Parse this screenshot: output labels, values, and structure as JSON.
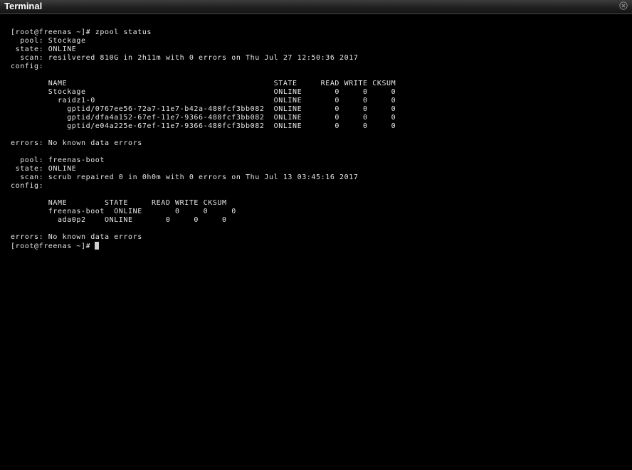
{
  "window": {
    "title": "Terminal",
    "close_icon": "close-icon"
  },
  "terminal": {
    "lines": [
      "[root@freenas ~]# zpool status",
      "  pool: Stockage",
      " state: ONLINE",
      "  scan: resilvered 810G in 2h11m with 0 errors on Thu Jul 27 12:50:36 2017",
      "config:",
      "",
      "        NAME                                            STATE     READ WRITE CKSUM",
      "        Stockage                                        ONLINE       0     0     0",
      "          raidz1-0                                      ONLINE       0     0     0",
      "            gptid/0767ee56-72a7-11e7-b42a-480fcf3bb082  ONLINE       0     0     0",
      "            gptid/dfa4a152-67ef-11e7-9366-480fcf3bb082  ONLINE       0     0     0",
      "            gptid/e04a225e-67ef-11e7-9366-480fcf3bb082  ONLINE       0     0     0",
      "",
      "errors: No known data errors",
      "",
      "  pool: freenas-boot",
      " state: ONLINE",
      "  scan: scrub repaired 0 in 0h0m with 0 errors on Thu Jul 13 03:45:16 2017",
      "config:",
      "",
      "        NAME        STATE     READ WRITE CKSUM",
      "        freenas-boot  ONLINE       0     0     0",
      "          ada0p2    ONLINE       0     0     0",
      "",
      "errors: No known data errors"
    ],
    "prompt": "[root@freenas ~]#"
  },
  "colors": {
    "background": "#000000",
    "text": "#e6e6e6",
    "titlebar": "#202020",
    "cursor": "#d0d0d0"
  }
}
